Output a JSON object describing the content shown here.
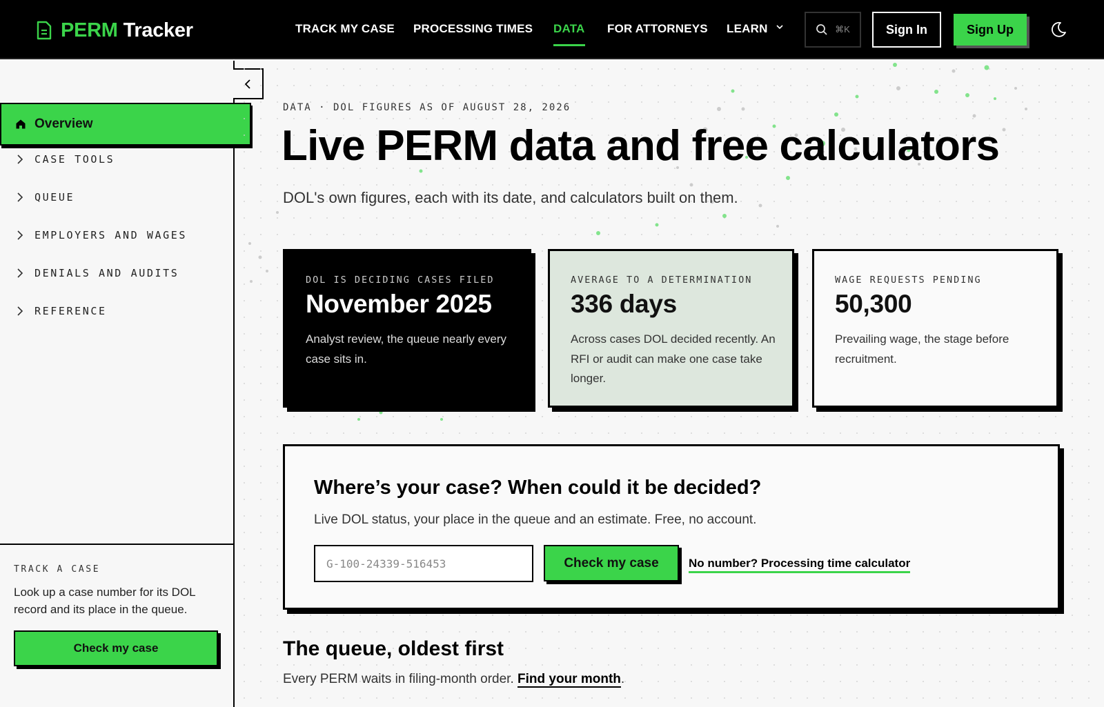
{
  "brand": {
    "word1": "PERM",
    "word2": "Tracker"
  },
  "nav": {
    "items": [
      {
        "label": "TRACK MY CASE"
      },
      {
        "label": "PROCESSING TIMES"
      },
      {
        "label": "DATA"
      },
      {
        "label": "FOR ATTORNEYS"
      },
      {
        "label": "LEARN"
      }
    ],
    "active": "DATA",
    "search_shortcut": "⌘K",
    "sign_in": "Sign In",
    "sign_up": "Sign Up"
  },
  "sidebar": {
    "overview": "Overview",
    "items": [
      {
        "label": "CASE TOOLS"
      },
      {
        "label": "QUEUE"
      },
      {
        "label": "EMPLOYERS AND WAGES"
      },
      {
        "label": "DENIALS AND AUDITS"
      },
      {
        "label": "REFERENCE"
      }
    ],
    "cta": {
      "kicker": "TRACK A CASE",
      "text": "Look up a case number for its DOL record and its place in the queue.",
      "button": "Check my case"
    }
  },
  "hero": {
    "kicker": "DATA · DOL FIGURES AS OF AUGUST 28, 2026",
    "title": "Live PERM data and free calculators",
    "subtitle": "DOL's own figures, each with its date, and calculators built on them."
  },
  "cards": [
    {
      "kicker": "DOL IS DECIDING CASES FILED",
      "value": "November 2025",
      "desc": "Analyst review, the queue nearly every case sits in."
    },
    {
      "kicker": "AVERAGE TO A DETERMINATION",
      "value": "336 days",
      "desc": "Across cases DOL decided recently. An RFI or audit can make one case take longer."
    },
    {
      "kicker": "WAGE REQUESTS PENDING",
      "value": "50,300",
      "desc": "Prevailing wage, the stage before recruitment."
    }
  ],
  "lookup": {
    "heading": "Where’s your case? When could it be decided?",
    "text": "Live DOL status, your place in the queue and an estimate. Free, no account.",
    "placeholder": "G-100-24339-516453",
    "button": "Check my case",
    "link": "No number? Processing time calculator"
  },
  "queue": {
    "title": "The queue, oldest first",
    "text": "Every PERM waits in filing-month order.",
    "link": "Find your month",
    "suffix": "."
  },
  "colors": {
    "accent": "#3bd44a",
    "ink": "#000000",
    "card_tint": "#dde7dd",
    "page_bg": "#f7f7f7"
  },
  "icons": [
    "document-icon",
    "chevron-down-icon",
    "search-icon",
    "moon-icon",
    "chevron-left-icon",
    "home-icon",
    "chevron-right-icon"
  ]
}
